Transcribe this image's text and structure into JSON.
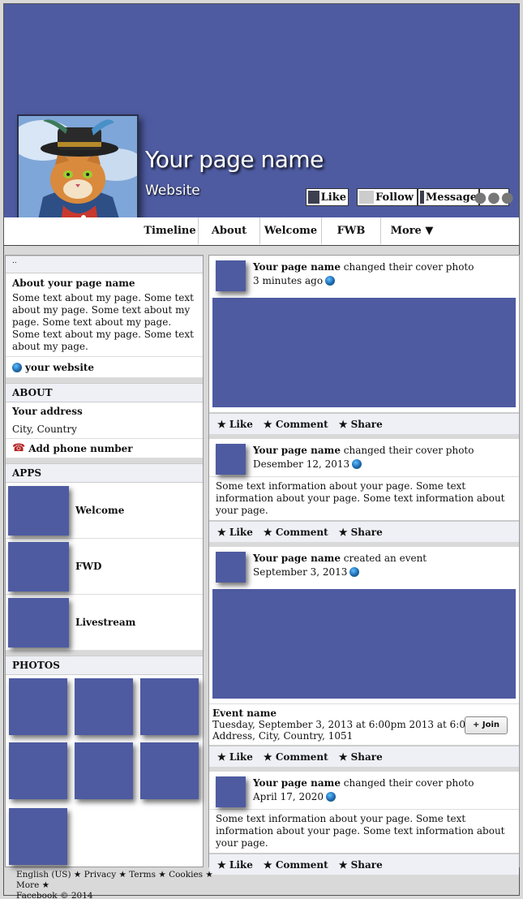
{
  "header": {
    "page_name": "Your page name",
    "website": "Website",
    "like_label": "Like",
    "follow_label": "Follow",
    "message_label": "Message",
    "more_dots": "●●●"
  },
  "nav": {
    "tabs": [
      "Timeline",
      "About",
      "Welcome",
      "FWB",
      "More ▼"
    ]
  },
  "sidebar": {
    "top_marker": "..",
    "about_page_title": "About your page name",
    "about_page_text": "Some text about my page. Some text about my page. Some text about my page. Some text about my page. Some text about my page. Some text about my page.",
    "website_label": "your website",
    "about_heading": "ABOUT",
    "address_label": "Your address",
    "city_country": "City, Country",
    "phone_label": "Add phone number",
    "apps_heading": "APPS",
    "apps": [
      "Welcome",
      "FWD",
      "Livestream"
    ],
    "photos_heading": "PHOTOS"
  },
  "feed": {
    "actions": {
      "like": "★ Like",
      "comment": "★ Comment",
      "share": "★ Share"
    },
    "posts": [
      {
        "author": "Your page name",
        "action": " changed their cover photo",
        "time": "3 minutes ago",
        "text": ""
      },
      {
        "author": "Your page name",
        "action": " changed their cover photo",
        "time": "Desember 12, 2013",
        "text": "Some text information about your page. Some text information about your page. Some text information about your page."
      },
      {
        "author": "Your page name",
        "action": " created an event",
        "time": "September 3, 2013",
        "text": ""
      },
      {
        "author": "Your page name",
        "action": " changed their cover photo",
        "time": "April 17, 2020",
        "text": "Some text information about your page. Some text information about your page. Some text information about your page."
      }
    ],
    "event": {
      "name": "Event name",
      "when": "Tuesday, September 3, 2013 at 6:00pm 2013 at 6:00pm",
      "where": "Address, City, Country, 1051",
      "join_label": "+ Join"
    }
  },
  "footer": {
    "line1": "English (US) ★ Privacy ★ Terms ★ Cookies ★ More ★",
    "line2": "Facebook © 2014"
  },
  "colors": {
    "accent": "#4e5ba1",
    "section_bg": "#eef0f6",
    "page_bg": "#d9d9d9"
  }
}
